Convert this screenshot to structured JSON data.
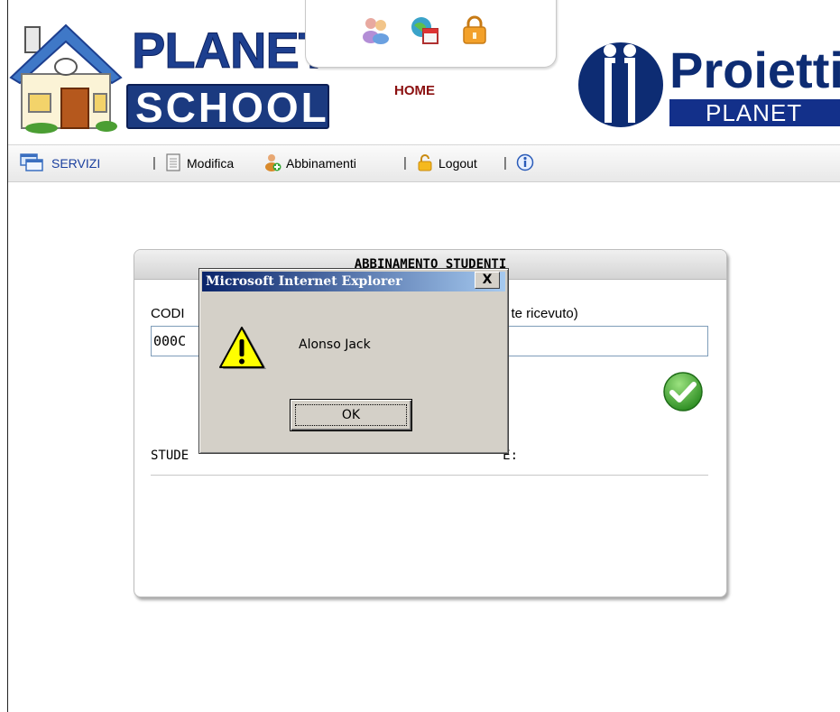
{
  "header": {
    "logo_planet": "PLANET",
    "logo_school": "SCHOOL",
    "home_label": "HOME",
    "home_icons": [
      "users-icon",
      "calendar-globe-icon",
      "lock-icon"
    ],
    "brand_word": "Proietti",
    "brand_sub": "PLANET"
  },
  "toolbar": {
    "servizi": "SERVIZI",
    "sep": "|",
    "modifica": "Modifica",
    "abbinamenti": "Abbinamenti",
    "logout": "Logout"
  },
  "panel": {
    "title": "ABBINAMENTO STUDENTI",
    "code_label_start": "CODI",
    "code_label_end": "te ricevuto)",
    "code_value": "000C",
    "assigned_start": "STUDE",
    "assigned_end": "E:"
  },
  "dialog": {
    "title": "Microsoft Internet Explorer",
    "close": "X",
    "message": "Alonso Jack",
    "ok": "OK"
  },
  "colors": {
    "brand_blue": "#1b3a80",
    "home_red": "#8b1010",
    "dialog_title_start": "#0a246a",
    "dialog_face": "#d4d0c8",
    "check_green": "#3ea22e"
  }
}
